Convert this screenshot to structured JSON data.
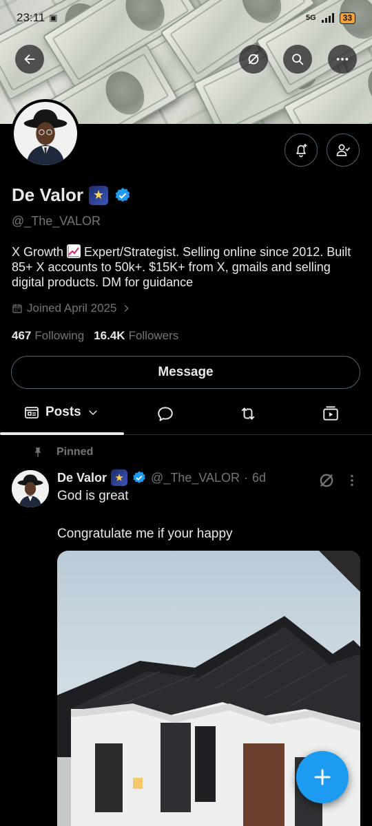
{
  "status_bar": {
    "time": "23:11",
    "network": "5G",
    "battery": "33"
  },
  "profile": {
    "name": "De Valor",
    "handle": "@_The_VALOR",
    "bio_part1": "X Growth ",
    "bio_part2": " Expert/Strategist. Selling online since 2012. Built 85+ X accounts to 50k+. $15K+ from X, gmails and selling digital products. DM for guidance",
    "joined": "Joined April 2025",
    "following_count": "467",
    "following_label": "Following",
    "followers_count": "16.4K",
    "followers_label": "Followers",
    "message_button": "Message"
  },
  "tabs": {
    "posts_label": "Posts"
  },
  "post": {
    "pinned_label": "Pinned",
    "author_name": "De Valor",
    "author_handle": "@_The_VALOR",
    "separator": "·",
    "age": "6d",
    "text_line1": "God is great",
    "text_line2": "Congratulate me if your happy"
  },
  "icons": {
    "back": "arrow-left-icon",
    "grok": "grok-icon",
    "search": "search-icon",
    "more": "more-icon",
    "notifications": "bell-plus-icon",
    "follow": "person-check-icon",
    "verified": "verified-badge-icon",
    "calendar": "calendar-icon",
    "posts": "posts-icon",
    "replies": "reply-icon",
    "reposts": "repost-icon",
    "media": "media-icon",
    "pin": "pin-icon",
    "compose": "plus-icon"
  },
  "colors": {
    "accent": "#1d9bf0",
    "text": "#e7e9ea",
    "muted": "#71767b",
    "border": "#2f3336",
    "background": "#000000"
  }
}
